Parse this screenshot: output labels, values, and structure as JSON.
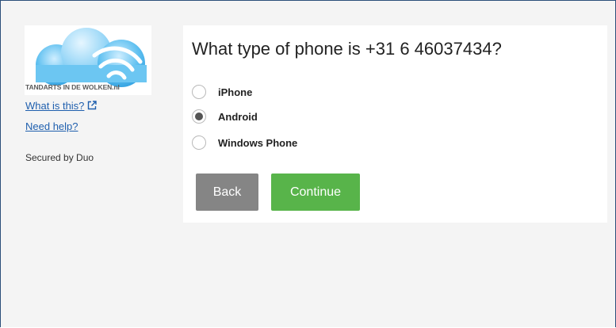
{
  "sidebar": {
    "logo_text": "TANDARTS IN DE WOLKEN.nl",
    "links": [
      {
        "label": "What is this?",
        "icon": "external-link-icon"
      },
      {
        "label": "Need help?"
      }
    ],
    "secured_text": "Secured by Duo"
  },
  "main": {
    "question": "What type of phone is +31 6 46037434?",
    "options": [
      {
        "label": "iPhone",
        "checked": false
      },
      {
        "label": "Android",
        "checked": true
      },
      {
        "label": "Windows Phone",
        "checked": false
      }
    ],
    "buttons": {
      "back_label": "Back",
      "continue_label": "Continue"
    }
  },
  "colors": {
    "continue_button": "#58b44a",
    "back_button": "#858585",
    "link": "#1f5fae",
    "page_background": "#f4f4f4"
  }
}
